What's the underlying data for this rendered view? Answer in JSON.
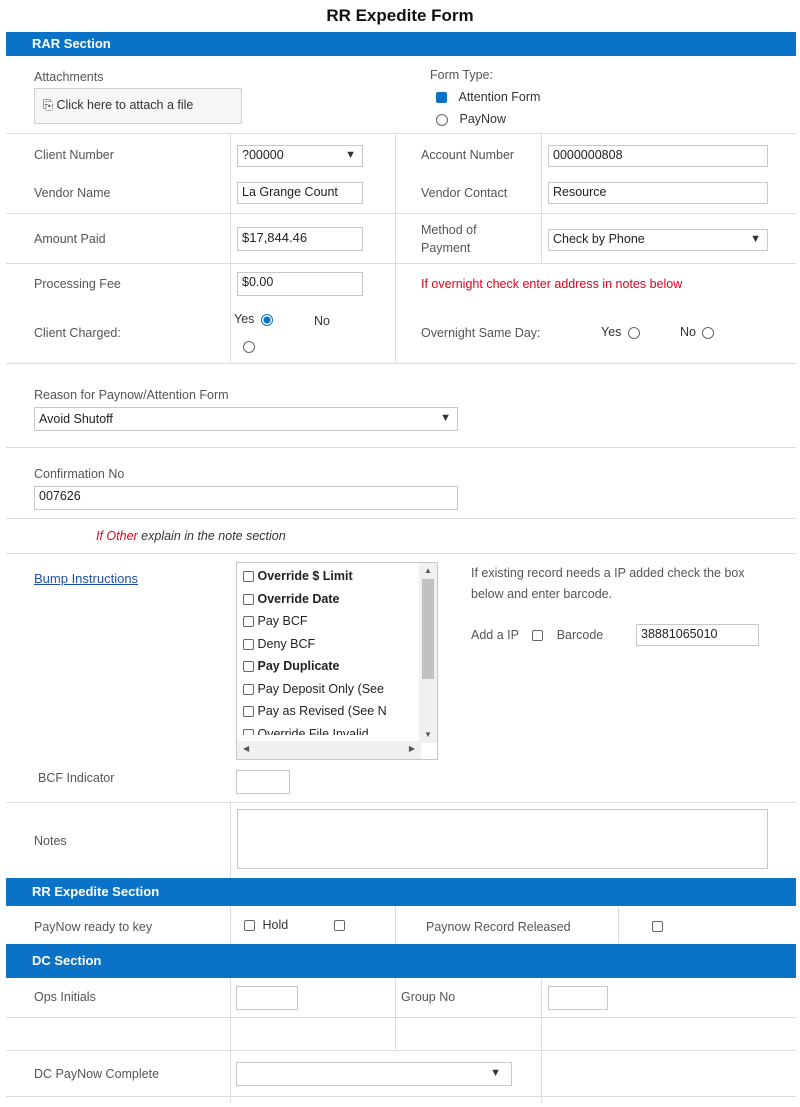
{
  "form_title": "RR Expedite Form",
  "sections": {
    "rar": "RAR Section",
    "rr_expedite": "RR Expedite Section",
    "dc": "DC Section"
  },
  "attachments": {
    "label": "Attachments",
    "button": "Click here to attach a file"
  },
  "form_type": {
    "label": "Form Type:",
    "options": [
      "Attention Form",
      "PayNow"
    ],
    "selected": "Attention Form"
  },
  "fields": {
    "client_number": {
      "label": "Client Number",
      "value": "?00000"
    },
    "account_number": {
      "label": "Account Number",
      "value": "0000000808"
    },
    "vendor_name": {
      "label": "Vendor Name",
      "value": "La Grange Count"
    },
    "vendor_contact": {
      "label": "Vendor Contact",
      "value": "Resource"
    },
    "amount_paid": {
      "label": "Amount Paid",
      "value": "$17,844.46"
    },
    "method_of_payment": {
      "label": "Method of Payment",
      "value": "Check by Phone"
    },
    "processing_fee": {
      "label": "Processing Fee",
      "value": "$0.00"
    },
    "overnight_note": "If overnight check enter address in notes below",
    "client_charged": {
      "label": "Client Charged:",
      "yes": "Yes",
      "no": "No"
    },
    "overnight_same_day": {
      "label": "Overnight Same Day:",
      "yes": "Yes",
      "no": "No"
    },
    "reason": {
      "label": "Reason for Paynow/Attention Form",
      "value": "Avoid Shutoff"
    },
    "confirmation_no": {
      "label": "Confirmation No",
      "value": "007626"
    },
    "other_note_prefix": "If Other",
    "other_note_suffix": " explain in the note section"
  },
  "instructions": {
    "link": "Bump Instructions",
    "items": [
      "Override $ Limit",
      "Override Date",
      "Pay BCF",
      "Deny BCF",
      "Pay Duplicate",
      "Pay Deposit Only (See",
      "Pay as Revised (See N",
      "Override File Invalid"
    ],
    "scroll_up": "▲",
    "scroll_down": "▼",
    "scroll_left": "◀",
    "scroll_right": "▶",
    "existing_note": "If existing record needs a IP added check the box below and enter barcode.",
    "add_ip": "Add a IP",
    "barcode_label": "Barcode",
    "barcode_value": "38881065010"
  },
  "bcf_indicator": {
    "label": "BCF Indicator",
    "value": ""
  },
  "notes": {
    "label": "Notes",
    "value": ""
  },
  "rr": {
    "paynow_ready": "PayNow ready to key",
    "hold": "Hold",
    "record_released": "Paynow Record Released"
  },
  "dc": {
    "ops_initials": "Ops Initials",
    "group_no": "Group No",
    "paynow_complete": "DC PayNow Complete"
  },
  "colors": {
    "section_bar": "#0a73c7",
    "warning_text": "#e0001b",
    "link": "#1d4fb0"
  }
}
